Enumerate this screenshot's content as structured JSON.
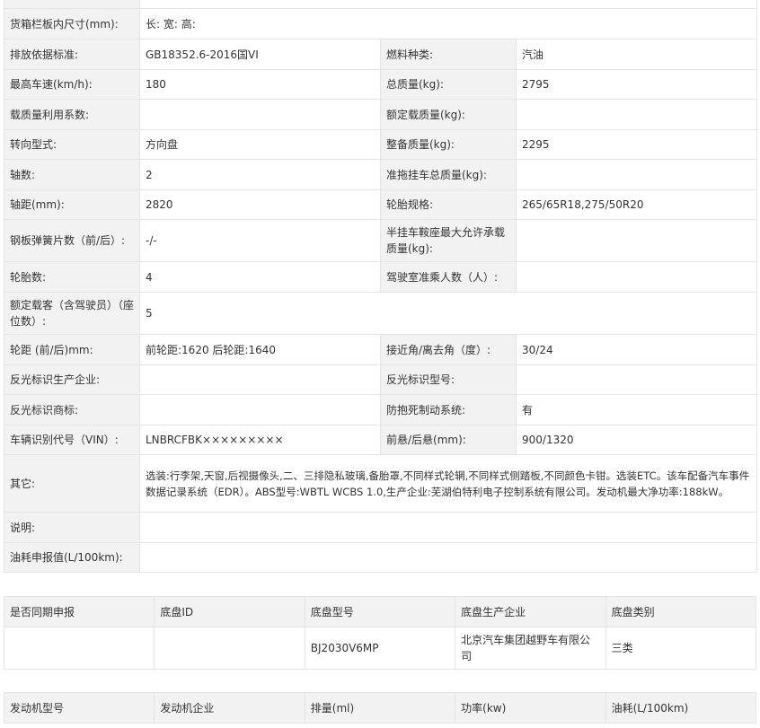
{
  "spec": {
    "cargo_box_size": {
      "label": "货箱栏板内尺寸(mm):",
      "value": "长:  宽:  高:"
    },
    "emission_standard": {
      "label": "排放依据标准:",
      "value": "GB18352.6-2016国VI"
    },
    "fuel_type": {
      "label": "燃料种类:",
      "value": "汽油"
    },
    "max_speed": {
      "label": "最高车速(km/h):",
      "value": "180"
    },
    "total_mass": {
      "label": "总质量(kg):",
      "value": "2795"
    },
    "load_utilization": {
      "label": "载质量利用系数:",
      "value": ""
    },
    "rated_load": {
      "label": "额定载质量(kg):",
      "value": ""
    },
    "steering": {
      "label": "转向型式:",
      "value": "方向盘"
    },
    "curb_weight": {
      "label": "整备质量(kg):",
      "value": "2295"
    },
    "axles": {
      "label": "轴数:",
      "value": "2"
    },
    "trailer_mass": {
      "label": "准拖挂车总质量(kg):",
      "value": ""
    },
    "wheelbase": {
      "label": "轴距(mm):",
      "value": "2820"
    },
    "tire_spec": {
      "label": "轮胎规格:",
      "value": "265/65R18,275/50R20"
    },
    "leaf_springs": {
      "label": "钢板弹簧片数（前/后）:",
      "value": "-/-"
    },
    "saddle_load": {
      "label": "半挂车鞍座最大允许承载质量(kg):",
      "value": ""
    },
    "tires": {
      "label": "轮胎数:",
      "value": "4"
    },
    "cab_seats": {
      "label": "驾驶室准乘人数（人）:",
      "value": ""
    },
    "passengers": {
      "label": "额定载客（含驾驶员）（座位数）:",
      "value": "5"
    },
    "track": {
      "label": "轮距 (前/后)mm:",
      "value": "前轮距:1620 后轮距:1640"
    },
    "angles": {
      "label": "接近角/离去角（度）:",
      "value": "30/24"
    },
    "reflector_maker": {
      "label": "反光标识生产企业:",
      "value": ""
    },
    "reflector_model": {
      "label": "反光标识型号:",
      "value": ""
    },
    "reflector_brand": {
      "label": "反光标识商标:",
      "value": ""
    },
    "abs": {
      "label": "防抱死制动系统:",
      "value": "有"
    },
    "vin": {
      "label": "车辆识别代号（VIN）:",
      "value": "LNBRCFBK×××××××××"
    },
    "overhang": {
      "label": "前悬/后悬(mm):",
      "value": "900/1320"
    },
    "other": {
      "label": "其它:",
      "value": "选装:行李架,天窗,后视摄像头,二、三排隐私玻璃,备胎罩,不同样式轮辋,不同样式侧踏板,不同颜色卡钳。选装ETC。该车配备汽车事件数据记录系统（EDR）。ABS型号:WBTL WCBS 1.0,生产企业:芜湖伯特利电子控制系统有限公司。发动机最大净功率:188kW。"
    },
    "notes": {
      "label": "说明:",
      "value": ""
    },
    "fuel_consumption": {
      "label": "油耗申报值(L/100km):",
      "value": ""
    }
  },
  "chassis": {
    "headers": [
      "是否同期申报",
      "底盘ID",
      "底盘型号",
      "底盘生产企业",
      "底盘类别"
    ],
    "row": [
      "",
      "",
      "BJ2030V6MP",
      "北京汽车集团越野车有限公司",
      "三类"
    ]
  },
  "engine": {
    "headers": [
      "发动机型号",
      "发动机企业",
      "排量(ml)",
      "功率(kw)",
      "油耗(L/100km)"
    ]
  }
}
